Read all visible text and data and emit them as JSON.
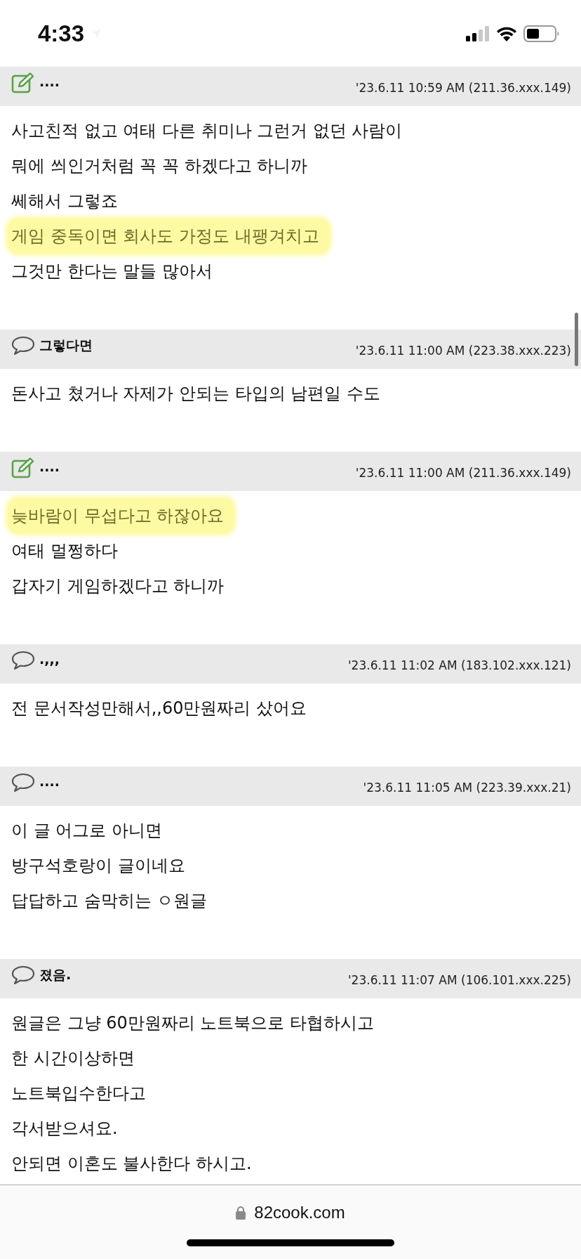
{
  "status_bar": {
    "time": "4:33"
  },
  "comments": [
    {
      "kind": "memo",
      "author": "....",
      "date": "'23.6.11 10:59 AM (211.36.xxx.149)",
      "lines": [
        {
          "text": "사고친적 없고 여태 다른 취미나 그런거 없던 사람이",
          "highlighted": false
        },
        {
          "text": "뭐에 씌인거처럼 꼭 꼭 하겠다고 하니까",
          "highlighted": false
        },
        {
          "text": "쎄해서 그렇죠",
          "highlighted": false
        },
        {
          "text": "게임 중독이면 회사도 가정도 내팽겨치고",
          "highlighted": true
        },
        {
          "text": "그것만 한다는 말들 많아서",
          "highlighted": false
        }
      ]
    },
    {
      "kind": "comment",
      "author": "그렇다면",
      "date": "'23.6.11 11:00 AM (223.38.xxx.223)",
      "lines": [
        {
          "text": "돈사고 쳤거나 자제가 안되는 타입의 남편일 수도",
          "highlighted": false
        }
      ]
    },
    {
      "kind": "memo",
      "author": "....",
      "date": "'23.6.11 11:00 AM (211.36.xxx.149)",
      "lines": [
        {
          "text": "늦바람이 무섭다고 하잖아요",
          "highlighted": true
        },
        {
          "text": "여태 멀쩡하다",
          "highlighted": false
        },
        {
          "text": "갑자기 게임하겠다고 하니까",
          "highlighted": false
        }
      ]
    },
    {
      "kind": "comment",
      "author": ".,,,",
      "date": "'23.6.11 11:02 AM (183.102.xxx.121)",
      "lines": [
        {
          "text": "전 문서작성만해서,,60만원짜리 샀어요",
          "highlighted": false
        }
      ]
    },
    {
      "kind": "comment",
      "author": "....",
      "date": "'23.6.11 11:05 AM (223.39.xxx.21)",
      "lines": [
        {
          "text": "이 글 어그로 아니면",
          "highlighted": false
        },
        {
          "text": "방구석호랑이 글이네요",
          "highlighted": false
        },
        {
          "text": "답답하고 숨막히는 ㅇ원글",
          "highlighted": false
        }
      ]
    },
    {
      "kind": "comment",
      "author": "졌음.",
      "date": "'23.6.11 11:07 AM (106.101.xxx.225)",
      "lines": [
        {
          "text": "원글은 그냥 60만원짜리 노트북으로 타협하시고",
          "highlighted": false
        },
        {
          "text": "한 시간이상하면",
          "highlighted": false
        },
        {
          "text": "노트북입수한다고",
          "highlighted": false
        },
        {
          "text": "각서받으셔요.",
          "highlighted": false
        },
        {
          "text": "안되면 이혼도 불사한다 하시고.",
          "highlighted": false
        }
      ]
    }
  ],
  "address_bar": {
    "url": "82cook.com"
  }
}
